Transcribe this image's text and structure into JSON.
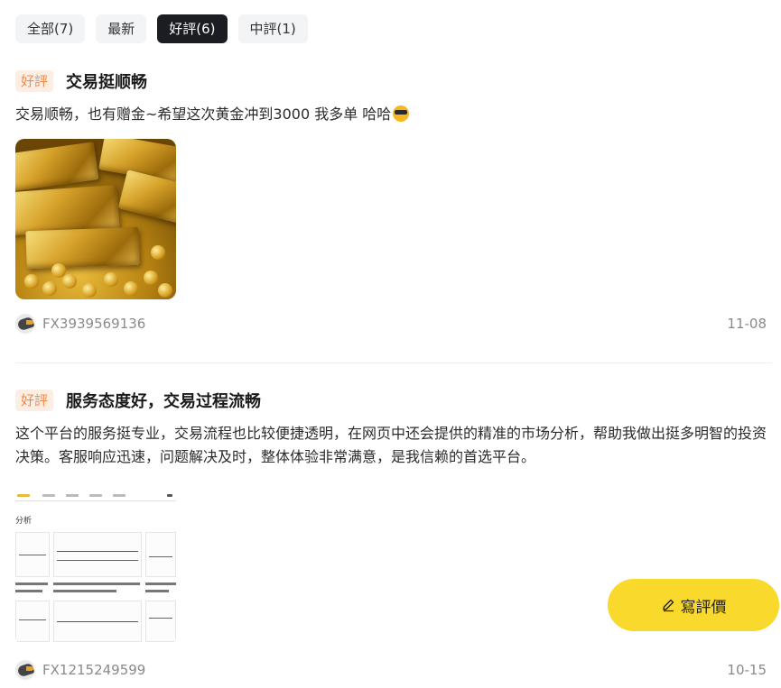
{
  "tabs": [
    {
      "label": "全部(7)",
      "active": false
    },
    {
      "label": "最新",
      "active": false
    },
    {
      "label": "好評(6)",
      "active": true
    },
    {
      "label": "中評(1)",
      "active": false
    }
  ],
  "reviews": [
    {
      "badge": "好評",
      "title": "交易挺顺畅",
      "text": "交易顺畅，也有赠金~希望这次黄金冲到3000 我多单 哈哈",
      "emoji": "sunglasses-emoji",
      "image": "gold-bars-photo",
      "user": "FX3939569136",
      "date": "11-08"
    },
    {
      "badge": "好評",
      "title": "服务态度好，交易过程流畅",
      "text": "这个平台的服务挺专业，交易流程也比较便捷透明，在网页中还会提供的精准的市场分析，帮助我做出挺多明智的投资决策。客服响应迅速，问题解决及时，整体体验非常满意，是我信赖的首选平台。",
      "image": "market-analysis-screenshot",
      "image_label": "分析",
      "user": "FX1215249599",
      "date": "10-15"
    }
  ],
  "write_button": {
    "label": "寫評價",
    "icon": "pen-icon",
    "color": "#f9d92b"
  },
  "colors": {
    "badge_bg": "#fdeee4",
    "badge_text": "#f08a4b",
    "active_tab": "#1b1d22"
  }
}
